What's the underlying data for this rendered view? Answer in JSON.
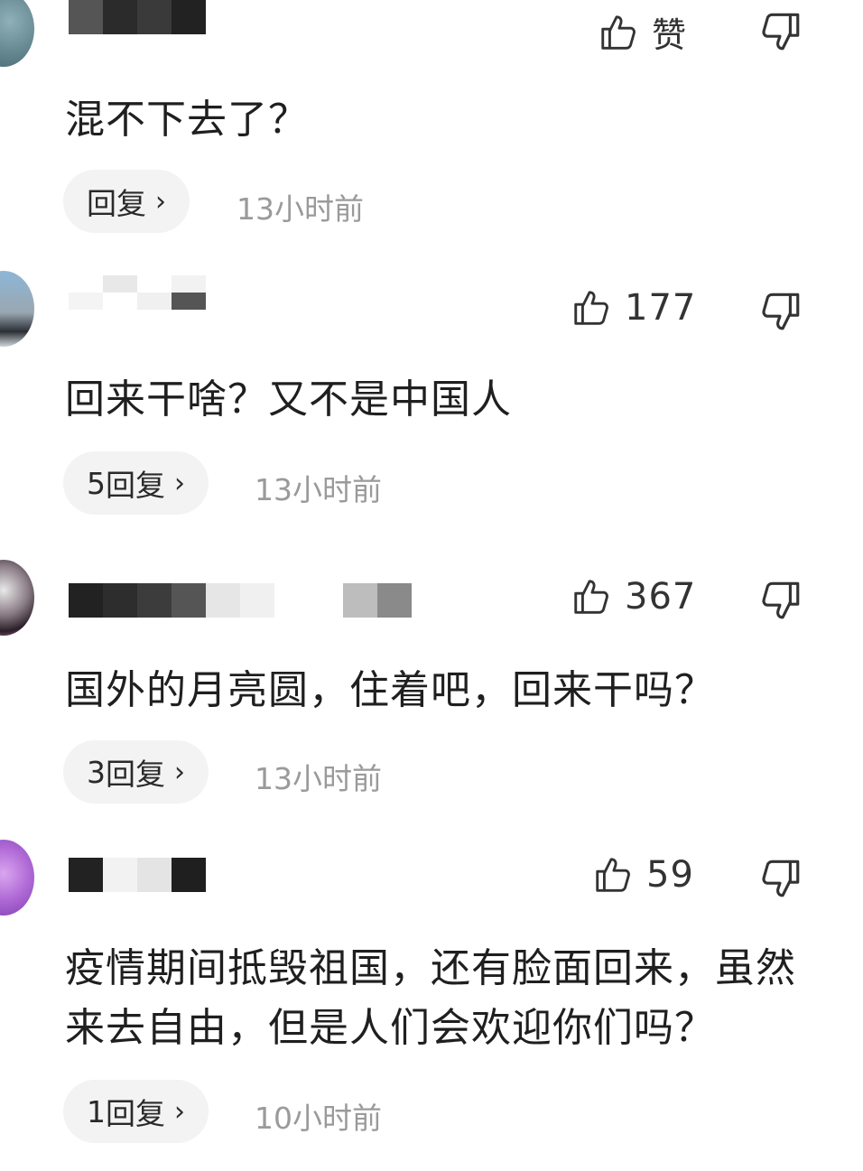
{
  "comments": [
    {
      "like_label": "赞",
      "like_count": "",
      "text": "混不下去了？",
      "reply_label": "回复",
      "reply_count": "",
      "time": "13小时前",
      "avatar_color": "#5a7f8a"
    },
    {
      "like_label": "",
      "like_count": "177",
      "text": "回来干啥？又不是中国人",
      "reply_label": "回复",
      "reply_count": "5",
      "time": "13小时前",
      "avatar_color": "#7d8a95"
    },
    {
      "like_label": "",
      "like_count": "367",
      "text": "国外的月亮圆，住着吧，回来干吗？",
      "reply_label": "回复",
      "reply_count": "3",
      "time": "13小时前",
      "avatar_color": "#4a3a44"
    },
    {
      "like_label": "",
      "like_count": "59",
      "text": "疫情期间抵毁祖国，还有脸面回来，虽然来去自由，但是人们会欢迎你们吗？",
      "reply_label": "回复",
      "reply_count": "1",
      "time": "10小时前",
      "avatar_color": "#b06ad6"
    }
  ],
  "icons": {
    "like": "thumbs-up-icon",
    "dislike": "thumbs-down-icon",
    "chevron": "chevron-right-icon"
  }
}
